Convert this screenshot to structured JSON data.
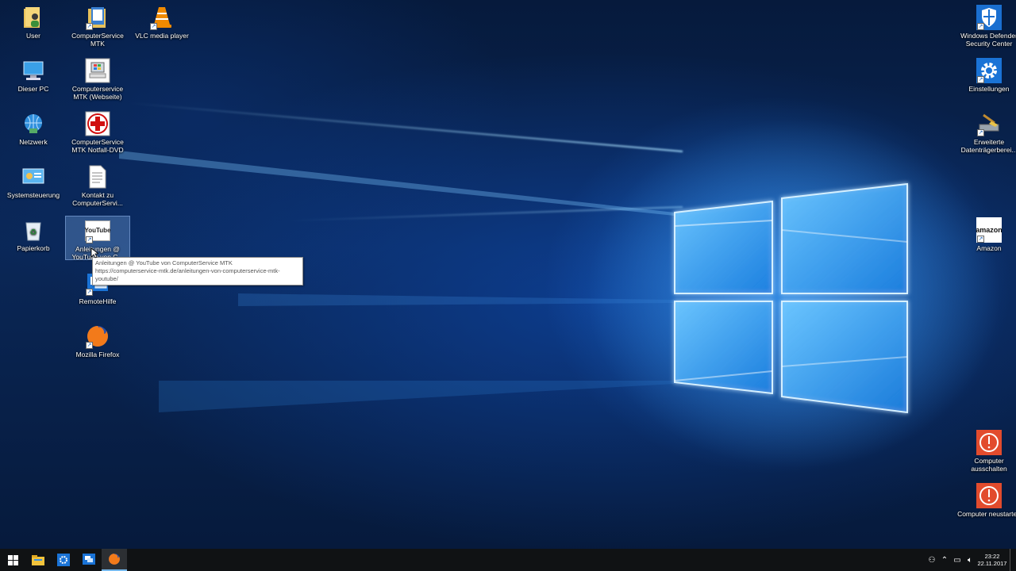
{
  "desktop_icons_left": [
    {
      "label": "User",
      "icon": "user-folder-icon"
    },
    {
      "label": "Dieser PC",
      "icon": "computer-icon"
    },
    {
      "label": "Netzwerk",
      "icon": "network-icon"
    },
    {
      "label": "Systemsteuerung",
      "icon": "control-panel-icon"
    },
    {
      "label": "Papierkorb",
      "icon": "recycle-bin-icon"
    }
  ],
  "desktop_icons_col2": [
    {
      "label": "ComputerService MTK",
      "icon": "folder-icon"
    },
    {
      "label": "Computerservice MTK (Webseite)",
      "icon": "website-icon"
    },
    {
      "label": "ComputerService MTK Notfall-DVD",
      "icon": "red-cross-icon"
    },
    {
      "label": "Kontakt zu ComputerServi...",
      "icon": "text-file-icon"
    },
    {
      "label": "Anleitungen @ YouTube von C...",
      "icon": "youtube-icon"
    },
    {
      "label": "RemoteHilfe",
      "icon": "remote-help-icon"
    },
    {
      "label": "Mozilla Firefox",
      "icon": "firefox-icon"
    }
  ],
  "desktop_icons_col3": [
    {
      "label": "VLC media player",
      "icon": "vlc-icon"
    }
  ],
  "desktop_icons_right": [
    {
      "label": "Windows Defender Security Center",
      "icon": "shield-icon"
    },
    {
      "label": "Einstellungen",
      "icon": "gear-icon"
    },
    {
      "label": "Erweiterte Datenträgerberei...",
      "icon": "disk-cleanup-icon"
    },
    {
      "label": "Amazon",
      "icon": "amazon-icon"
    },
    {
      "label": "Computer ausschalten",
      "icon": "power-icon"
    },
    {
      "label": "Computer neustarten",
      "icon": "restart-icon"
    }
  ],
  "tooltip": {
    "line1": "Anleitungen @ YouTube von ComputerService MTK",
    "line2": "https://computerservice-mtk.de/anleitungen-von-computerservice-mtk-youtube/"
  },
  "amazon_text": "amazon",
  "youtube_text": "YouTube",
  "taskbar": {
    "items": [
      "start-icon",
      "file-explorer-icon",
      "settings-icon",
      "remote-help-icon",
      "firefox-icon"
    ],
    "clock_time": "23:22",
    "clock_date": "22.11.2017"
  },
  "colors": {
    "accent": "#76b9ed",
    "taskbar": "#101214",
    "logo_glow": "#8fd3ff"
  }
}
